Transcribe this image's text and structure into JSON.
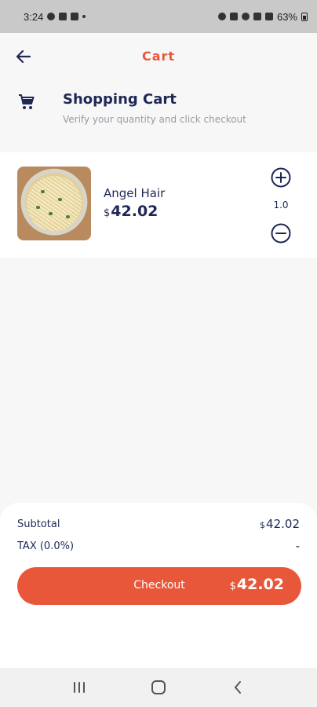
{
  "status_bar": {
    "time": "3:24",
    "battery": "63%"
  },
  "header": {
    "title": "Cart",
    "back_icon": "arrow-left-icon"
  },
  "section": {
    "icon": "shopping-cart-icon",
    "title": "Shopping Cart",
    "subtitle": "Verify your quantity and click checkout"
  },
  "items": [
    {
      "name": "Angel Hair",
      "currency": "$",
      "price": "42.02",
      "quantity": "1.0"
    }
  ],
  "summary": {
    "subtotal_label": "Subtotal",
    "subtotal_currency": "$",
    "subtotal_value": "42.02",
    "tax_label": "TAX (0.0%)",
    "tax_value": "-",
    "checkout_label": "Checkout",
    "checkout_currency": "$",
    "checkout_total": "42.02"
  },
  "colors": {
    "accent": "#e8573a",
    "primary_text": "#1f2855",
    "muted_text": "#9a9aa6"
  },
  "nav": {
    "recents_icon": "recents-icon",
    "home_icon": "home-icon",
    "back_icon": "nav-back-icon"
  }
}
